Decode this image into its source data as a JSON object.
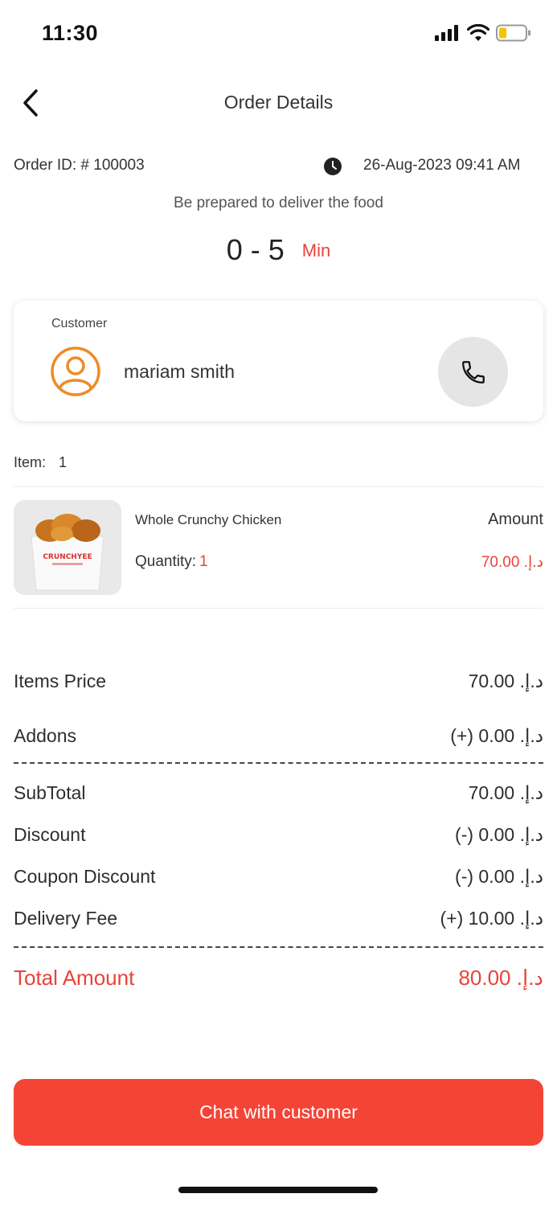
{
  "status_bar": {
    "time": "11:30",
    "icons": [
      "signal-icon",
      "wifi-icon",
      "battery-icon"
    ]
  },
  "header": {
    "title": "Order Details",
    "back_icon": "chevron-left-icon"
  },
  "order": {
    "id": "Order ID: # 100003",
    "date": "26-Aug-2023 09:41 AM",
    "prep_text": "Be prepared to deliver the food",
    "eta_range": "0 - 5",
    "eta_unit": "Min"
  },
  "customer": {
    "label": "Customer",
    "name": "mariam smith",
    "avatar_icon": "user-icon",
    "call_icon": "phone-icon"
  },
  "items": {
    "label": "Item:",
    "count": "1",
    "list": [
      {
        "name": "Whole Crunchy Chicken",
        "quantity_label": "Quantity:",
        "quantity": "1",
        "amount_label": "Amount",
        "price": "70.00 .د.إ",
        "image_text": "CRUNCHYEE"
      }
    ]
  },
  "summary": {
    "items_price": {
      "label": "Items Price",
      "value": "70.00 .د.إ"
    },
    "addons": {
      "label": "Addons",
      "value": "(+) 0.00 .د.إ"
    },
    "subtotal": {
      "label": "SubTotal",
      "value": "70.00 .د.إ"
    },
    "discount": {
      "label": "Discount",
      "value": "(-) 0.00 .د.إ"
    },
    "coupon_discount": {
      "label": "Coupon Discount",
      "value": "(-) 0.00 .د.إ"
    },
    "delivery_fee": {
      "label": "Delivery Fee",
      "value": "(+) 10.00 .د.إ"
    },
    "total": {
      "label": "Total Amount",
      "value": "80.00 .د.إ"
    }
  },
  "actions": {
    "chat_button": "Chat with customer"
  },
  "colors": {
    "accent": "#f44436",
    "text": "#2e2e2e",
    "card_shadow": "#e0e0e0"
  }
}
